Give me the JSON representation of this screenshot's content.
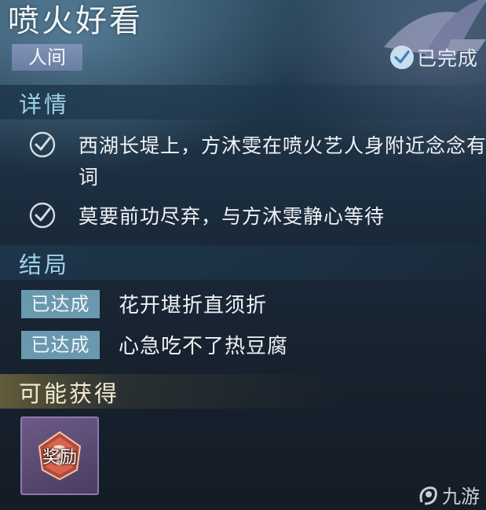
{
  "quest": {
    "title": "喷火好看",
    "realm_tag": "人间",
    "status": "已完成"
  },
  "details": {
    "heading": "详情",
    "conditions": [
      {
        "text": "西湖长堤上，方沐雯在喷火艺人身附近念念有词",
        "completed": true
      },
      {
        "text": "莫要前功尽弃，与方沐雯静心等待",
        "completed": true
      }
    ]
  },
  "endings": {
    "heading": "结局",
    "items": [
      {
        "tag": "已达成",
        "text": "花开堪折直须折"
      },
      {
        "tag": "已达成",
        "text": "心急吃不了热豆腐"
      }
    ]
  },
  "rewards": {
    "heading": "可能获得",
    "items": [
      {
        "label": "奖励",
        "icon": "question-mark-emblem-icon"
      }
    ]
  },
  "watermark": {
    "text": "九游",
    "icon": "nine-game-logo-icon"
  },
  "colors": {
    "section_heading": "#9fd1ea",
    "ending_tag": "#6a98ae",
    "realm_tag": "#7f93b6",
    "reward_frame": "#6d5a86"
  }
}
